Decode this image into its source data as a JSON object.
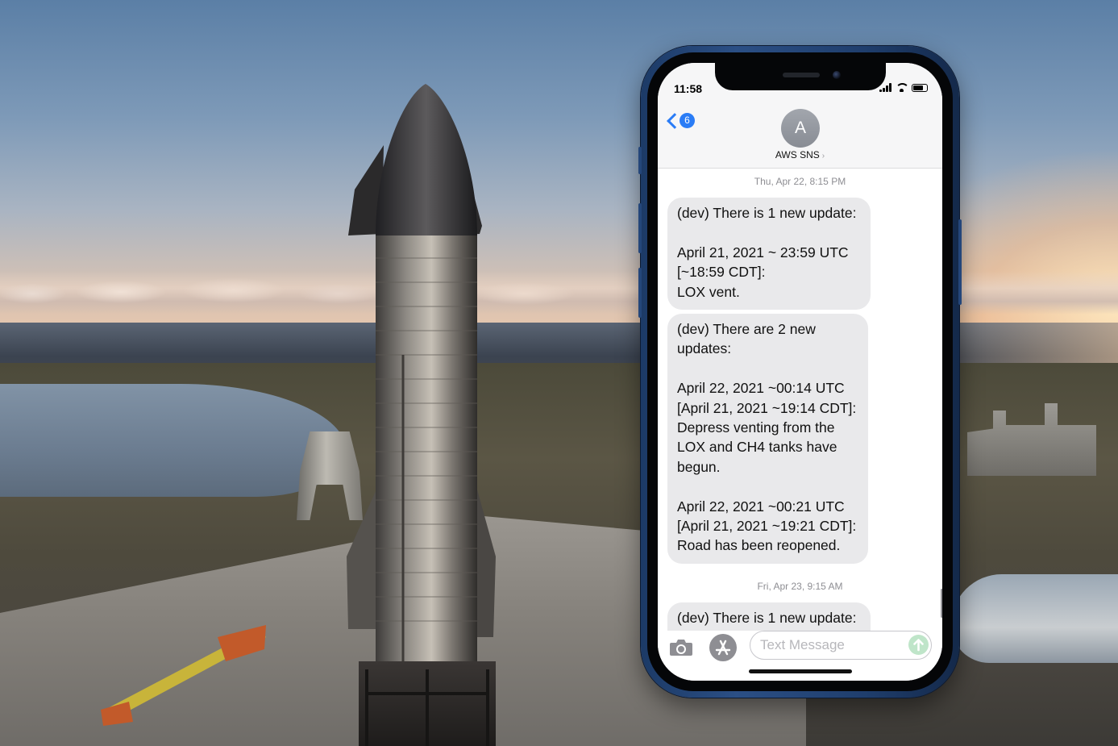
{
  "status_bar": {
    "time": "11:58",
    "battery_level": 0.75,
    "signal_bars": 4
  },
  "header": {
    "back_badge_count": "6",
    "avatar_initial": "A",
    "contact_name": "AWS SNS",
    "contact_chevron": "›"
  },
  "thread": [
    {
      "timestamp": "Thu, Apr 22, 8:15 PM",
      "bubbles": [
        {
          "lines": [
            "(dev) There is 1 new update:",
            "",
            "April 21, 2021 ~ 23:59 UTC",
            "[~18:59 CDT]:",
            "LOX vent."
          ]
        },
        {
          "lines": [
            "(dev) There are 2 new",
            "updates:",
            "",
            "April 22, 2021 ~00:14 UTC",
            "[April 21, 2021 ~19:14 CDT]:",
            "Depress venting from the",
            "LOX and CH4 tanks have",
            "begun.",
            "",
            "April 22, 2021 ~00:21 UTC",
            "[April 21, 2021 ~19:21 CDT]:",
            "Road has been reopened."
          ]
        }
      ]
    },
    {
      "timestamp": "Fri, Apr 23, 9:15 AM",
      "bubbles": [
        {
          "lines": [
            "(dev) There is 1 new update:"
          ]
        }
      ]
    }
  ],
  "compose": {
    "placeholder": "Text Message",
    "value": "",
    "camera_icon": "camera-icon",
    "app_store_icon": "app-store-icon",
    "send_icon": "arrow-up-icon"
  },
  "colors": {
    "ios_blue": "#2a7cf6",
    "bubble_gray": "#e9e9eb",
    "phone_frame": "#24467a",
    "send_disabled": "#bfe5c9"
  }
}
